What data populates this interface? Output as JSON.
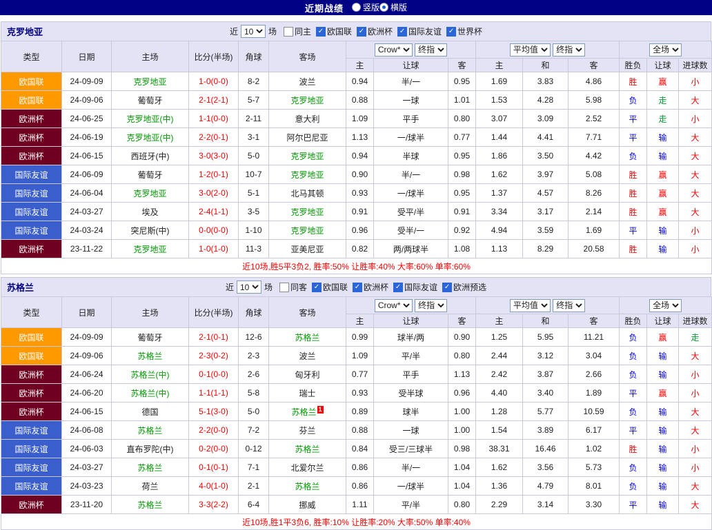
{
  "topbar": {
    "title": "近期战绩",
    "radios": [
      {
        "label": "竖版",
        "selected": false
      },
      {
        "label": "横版",
        "selected": true
      }
    ]
  },
  "columns": {
    "type": "类型",
    "date": "日期",
    "home": "主场",
    "score": "比分(半场)",
    "corner": "角球",
    "away": "客场",
    "odds_home": "主",
    "odds_handicap": "让球",
    "odds_away": "客",
    "avg_home": "主",
    "avg_draw": "和",
    "avg_away": "客",
    "result": "胜负",
    "handicap_result": "让球",
    "goals": "进球数"
  },
  "type_colors": {
    "欧国联": "#ff9900",
    "欧洲杯": "#70001f",
    "国际友谊": "#3a5fcd"
  },
  "value_colors": {
    "r": "#ff0000",
    "b": "#0000ee",
    "g": "#009933"
  },
  "focus_team_color": "#009900",
  "sections": [
    {
      "team": "克罗地亚",
      "near_prefix": "近",
      "near_select": "10",
      "near_suffix": "场",
      "filters": [
        {
          "label": "同主",
          "checked": false
        },
        {
          "label": "欧国联",
          "checked": true
        },
        {
          "label": "欧洲杯",
          "checked": true
        },
        {
          "label": "国际友谊",
          "checked": true
        },
        {
          "label": "世界杯",
          "checked": true
        }
      ],
      "selects": {
        "odds_company": "Crow*",
        "odds_time": "终指",
        "avg": "平均值",
        "avg_time": "终指",
        "scope": "全场"
      },
      "rows": [
        {
          "type": "欧国联",
          "date": "24-09-09",
          "home": "克罗地亚",
          "hf": true,
          "score": "1-0(0-0)",
          "corner": "8-2",
          "away": "波兰",
          "af": false,
          "odds": [
            "0.94",
            "半/一",
            "0.95"
          ],
          "avg": [
            "1.69",
            "3.83",
            "4.86"
          ],
          "res": [
            "胜",
            "r"
          ],
          "cov": [
            "赢",
            "r"
          ],
          "goal": [
            "小",
            "r"
          ]
        },
        {
          "type": "欧国联",
          "date": "24-09-06",
          "home": "葡萄牙",
          "hf": false,
          "score": "2-1(2-1)",
          "corner": "5-7",
          "away": "克罗地亚",
          "af": true,
          "odds": [
            "0.88",
            "一球",
            "1.01"
          ],
          "avg": [
            "1.53",
            "4.28",
            "5.98"
          ],
          "res": [
            "负",
            "b"
          ],
          "cov": [
            "走",
            "g"
          ],
          "goal": [
            "大",
            "r"
          ]
        },
        {
          "type": "欧洲杯",
          "date": "24-06-25",
          "home": "克罗地亚(中)",
          "hf": true,
          "score": "1-1(0-0)",
          "corner": "2-11",
          "away": "意大利",
          "af": false,
          "odds": [
            "1.09",
            "平手",
            "0.80"
          ],
          "avg": [
            "3.07",
            "3.09",
            "2.52"
          ],
          "res": [
            "平",
            "b"
          ],
          "cov": [
            "走",
            "g"
          ],
          "goal": [
            "小",
            "r"
          ]
        },
        {
          "type": "欧洲杯",
          "date": "24-06-19",
          "home": "克罗地亚(中)",
          "hf": true,
          "score": "2-2(0-1)",
          "corner": "3-1",
          "away": "阿尔巴尼亚",
          "af": false,
          "odds": [
            "1.13",
            "一/球半",
            "0.77"
          ],
          "avg": [
            "1.44",
            "4.41",
            "7.71"
          ],
          "res": [
            "平",
            "b"
          ],
          "cov": [
            "输",
            "b"
          ],
          "goal": [
            "大",
            "r"
          ]
        },
        {
          "type": "欧洲杯",
          "date": "24-06-15",
          "home": "西班牙(中)",
          "hf": false,
          "score": "3-0(3-0)",
          "corner": "5-0",
          "away": "克罗地亚",
          "af": true,
          "odds": [
            "0.94",
            "半球",
            "0.95"
          ],
          "avg": [
            "1.86",
            "3.50",
            "4.42"
          ],
          "res": [
            "负",
            "b"
          ],
          "cov": [
            "输",
            "b"
          ],
          "goal": [
            "大",
            "r"
          ]
        },
        {
          "type": "国际友谊",
          "date": "24-06-09",
          "home": "葡萄牙",
          "hf": false,
          "score": "1-2(0-1)",
          "corner": "10-7",
          "away": "克罗地亚",
          "af": true,
          "odds": [
            "0.90",
            "半/一",
            "0.98"
          ],
          "avg": [
            "1.62",
            "3.97",
            "5.08"
          ],
          "res": [
            "胜",
            "r"
          ],
          "cov": [
            "赢",
            "r"
          ],
          "goal": [
            "大",
            "r"
          ]
        },
        {
          "type": "国际友谊",
          "date": "24-06-04",
          "home": "克罗地亚",
          "hf": true,
          "score": "3-0(2-0)",
          "corner": "5-1",
          "away": "北马其顿",
          "af": false,
          "odds": [
            "0.93",
            "一/球半",
            "0.95"
          ],
          "avg": [
            "1.37",
            "4.57",
            "8.26"
          ],
          "res": [
            "胜",
            "r"
          ],
          "cov": [
            "赢",
            "r"
          ],
          "goal": [
            "大",
            "r"
          ]
        },
        {
          "type": "国际友谊",
          "date": "24-03-27",
          "home": "埃及",
          "hf": false,
          "score": "2-4(1-1)",
          "corner": "3-5",
          "away": "克罗地亚",
          "af": true,
          "odds": [
            "0.91",
            "受平/半",
            "0.91"
          ],
          "avg": [
            "3.34",
            "3.17",
            "2.14"
          ],
          "res": [
            "胜",
            "r"
          ],
          "cov": [
            "赢",
            "r"
          ],
          "goal": [
            "大",
            "r"
          ]
        },
        {
          "type": "国际友谊",
          "date": "24-03-24",
          "home": "突尼斯(中)",
          "hf": false,
          "score": "0-0(0-0)",
          "corner": "1-10",
          "away": "克罗地亚",
          "af": true,
          "odds": [
            "0.96",
            "受半/一",
            "0.92"
          ],
          "avg": [
            "4.94",
            "3.59",
            "1.69"
          ],
          "res": [
            "平",
            "b"
          ],
          "cov": [
            "输",
            "b"
          ],
          "goal": [
            "小",
            "r"
          ]
        },
        {
          "type": "欧洲杯",
          "date": "23-11-22",
          "home": "克罗地亚",
          "hf": true,
          "score": "1-0(1-0)",
          "corner": "11-3",
          "away": "亚美尼亚",
          "af": false,
          "odds": [
            "0.82",
            "两/两球半",
            "1.08"
          ],
          "avg": [
            "1.13",
            "8.29",
            "20.58"
          ],
          "res": [
            "胜",
            "r"
          ],
          "cov": [
            "输",
            "b"
          ],
          "goal": [
            "小",
            "r"
          ]
        }
      ],
      "summary": "近10场,胜5平3负2, 胜率:50% 让胜率:40% 大率:60% 单率:60%"
    },
    {
      "team": "苏格兰",
      "near_prefix": "近",
      "near_select": "10",
      "near_suffix": "场",
      "filters": [
        {
          "label": "同客",
          "checked": false
        },
        {
          "label": "欧国联",
          "checked": true
        },
        {
          "label": "欧洲杯",
          "checked": true
        },
        {
          "label": "国际友谊",
          "checked": true
        },
        {
          "label": "欧洲预选",
          "checked": true
        }
      ],
      "selects": {
        "odds_company": "Crow*",
        "odds_time": "终指",
        "avg": "平均值",
        "avg_time": "终指",
        "scope": "全场"
      },
      "rows": [
        {
          "type": "欧国联",
          "date": "24-09-09",
          "home": "葡萄牙",
          "hf": false,
          "score": "2-1(0-1)",
          "corner": "12-6",
          "away": "苏格兰",
          "af": true,
          "odds": [
            "0.99",
            "球半/两",
            "0.90"
          ],
          "avg": [
            "1.25",
            "5.95",
            "11.21"
          ],
          "res": [
            "负",
            "b"
          ],
          "cov": [
            "赢",
            "r"
          ],
          "goal": [
            "走",
            "g"
          ]
        },
        {
          "type": "欧国联",
          "date": "24-09-06",
          "home": "苏格兰",
          "hf": true,
          "score": "2-3(0-2)",
          "corner": "2-3",
          "away": "波兰",
          "af": false,
          "odds": [
            "1.09",
            "平/半",
            "0.80"
          ],
          "avg": [
            "2.44",
            "3.12",
            "3.04"
          ],
          "res": [
            "负",
            "b"
          ],
          "cov": [
            "输",
            "b"
          ],
          "goal": [
            "大",
            "r"
          ]
        },
        {
          "type": "欧洲杯",
          "date": "24-06-24",
          "home": "苏格兰(中)",
          "hf": true,
          "score": "0-1(0-0)",
          "corner": "2-6",
          "away": "匈牙利",
          "af": false,
          "odds": [
            "0.77",
            "平手",
            "1.13"
          ],
          "avg": [
            "2.42",
            "3.87",
            "2.66"
          ],
          "res": [
            "负",
            "b"
          ],
          "cov": [
            "输",
            "b"
          ],
          "goal": [
            "小",
            "r"
          ]
        },
        {
          "type": "欧洲杯",
          "date": "24-06-20",
          "home": "苏格兰(中)",
          "hf": true,
          "score": "1-1(1-1)",
          "corner": "5-8",
          "away": "瑞士",
          "af": false,
          "odds": [
            "0.93",
            "受半球",
            "0.96"
          ],
          "avg": [
            "4.40",
            "3.40",
            "1.89"
          ],
          "res": [
            "平",
            "b"
          ],
          "cov": [
            "赢",
            "r"
          ],
          "goal": [
            "小",
            "r"
          ]
        },
        {
          "type": "欧洲杯",
          "date": "24-06-15",
          "home": "德国",
          "hf": false,
          "score": "5-1(3-0)",
          "corner": "5-0",
          "away": "苏格兰",
          "af": true,
          "away_badge": "1",
          "odds": [
            "0.89",
            "球半",
            "1.00"
          ],
          "avg": [
            "1.28",
            "5.77",
            "10.59"
          ],
          "res": [
            "负",
            "b"
          ],
          "cov": [
            "输",
            "b"
          ],
          "goal": [
            "大",
            "r"
          ]
        },
        {
          "type": "国际友谊",
          "date": "24-06-08",
          "home": "苏格兰",
          "hf": true,
          "score": "2-2(0-0)",
          "corner": "7-2",
          "away": "芬兰",
          "af": false,
          "odds": [
            "0.88",
            "一球",
            "1.00"
          ],
          "avg": [
            "1.54",
            "3.89",
            "6.17"
          ],
          "res": [
            "平",
            "b"
          ],
          "cov": [
            "输",
            "b"
          ],
          "goal": [
            "大",
            "r"
          ]
        },
        {
          "type": "国际友谊",
          "date": "24-06-03",
          "home": "直布罗陀(中)",
          "hf": false,
          "score": "0-2(0-0)",
          "corner": "0-12",
          "away": "苏格兰",
          "af": true,
          "odds": [
            "0.84",
            "受三/三球半",
            "0.98"
          ],
          "avg": [
            "38.31",
            "16.46",
            "1.02"
          ],
          "res": [
            "胜",
            "r"
          ],
          "cov": [
            "输",
            "b"
          ],
          "goal": [
            "小",
            "r"
          ]
        },
        {
          "type": "国际友谊",
          "date": "24-03-27",
          "home": "苏格兰",
          "hf": true,
          "score": "0-1(0-1)",
          "corner": "7-1",
          "away": "北爱尔兰",
          "af": false,
          "odds": [
            "0.86",
            "半/一",
            "1.04"
          ],
          "avg": [
            "1.62",
            "3.56",
            "5.73"
          ],
          "res": [
            "负",
            "b"
          ],
          "cov": [
            "输",
            "b"
          ],
          "goal": [
            "小",
            "r"
          ]
        },
        {
          "type": "国际友谊",
          "date": "24-03-23",
          "home": "荷兰",
          "hf": false,
          "score": "4-0(1-0)",
          "corner": "2-1",
          "away": "苏格兰",
          "af": true,
          "odds": [
            "0.86",
            "一/球半",
            "1.04"
          ],
          "avg": [
            "1.36",
            "4.79",
            "8.01"
          ],
          "res": [
            "负",
            "b"
          ],
          "cov": [
            "输",
            "b"
          ],
          "goal": [
            "大",
            "r"
          ]
        },
        {
          "type": "欧洲杯",
          "date": "23-11-20",
          "home": "苏格兰",
          "hf": true,
          "score": "3-3(2-2)",
          "corner": "6-4",
          "away": "挪威",
          "af": false,
          "odds": [
            "1.11",
            "平/半",
            "0.80"
          ],
          "avg": [
            "2.29",
            "3.14",
            "3.30"
          ],
          "res": [
            "平",
            "b"
          ],
          "cov": [
            "输",
            "b"
          ],
          "goal": [
            "大",
            "r"
          ]
        }
      ],
      "summary": "近10场,胜1平3负6, 胜率:10% 让胜率:20% 大率:50% 单率:40%"
    }
  ]
}
